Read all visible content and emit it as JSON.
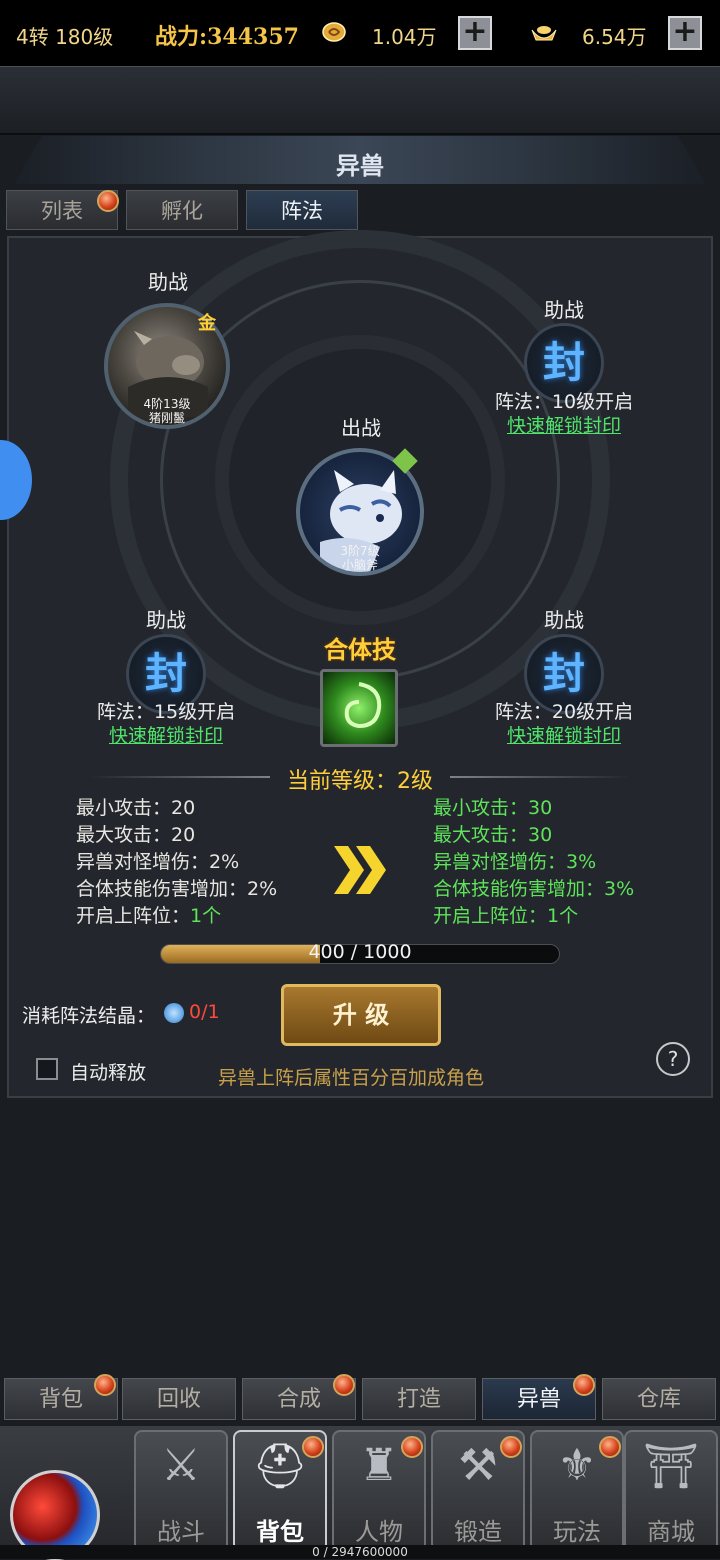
{
  "resources": {
    "level": "4转 180级",
    "power": "战力:344357",
    "coin_amount": "1.04万",
    "ingot_amount": "6.54万"
  },
  "header": {
    "title": "异兽"
  },
  "tabs": [
    {
      "label": "列表",
      "badge": true
    },
    {
      "label": "孵化"
    },
    {
      "label": "阵法",
      "active": true
    }
  ],
  "formation": {
    "support_label": "助战",
    "battle_label": "出战",
    "seal_glyph": "封",
    "quick_unlock": "快速解锁封印",
    "slot_top_left": {
      "caption_rank": "4阶13级",
      "caption_name": "猪刚鬣",
      "badge": "金"
    },
    "slot_center": {
      "caption_rank": "3阶7级",
      "caption_name": "小脑斧"
    },
    "slot_top_right": {
      "unlock": "阵法：10级开启"
    },
    "slot_bottom_left": {
      "unlock": "阵法：15级开启"
    },
    "slot_bottom_right": {
      "unlock": "阵法：20级开启"
    },
    "combo_skill_label": "合体技"
  },
  "level_info": {
    "current_level": "当前等级：2级"
  },
  "stats_current": [
    "最小攻击：20",
    "最大攻击：20",
    "异兽对怪增伤：2%",
    "合体技能伤害增加：2%"
  ],
  "stats_current_slots": {
    "label": "开启上阵位：",
    "value": "1个"
  },
  "stats_next": [
    "最小攻击：30",
    "最大攻击：30",
    "异兽对怪增伤：3%",
    "合体技能伤害增加：3%",
    "开启上阵位：1个"
  ],
  "progress": {
    "text": "400 / 1000",
    "fraction": 0.4
  },
  "cost": {
    "label": "消耗阵法结晶：",
    "value": "0/1"
  },
  "upgrade_button": "升 级",
  "auto_release": "自动释放",
  "hint": "异兽上阵后属性百分百加成角色",
  "help_glyph": "?",
  "bottom_tabs": [
    {
      "label": "背包",
      "badge": true
    },
    {
      "label": "回收"
    },
    {
      "label": "合成",
      "badge": true
    },
    {
      "label": "打造"
    },
    {
      "label": "异兽",
      "badge": true,
      "active": true
    },
    {
      "label": "仓库"
    }
  ],
  "nav": [
    {
      "label": "战斗"
    },
    {
      "label": "背包",
      "badge": true,
      "active": true
    },
    {
      "label": "人物",
      "badge": true
    },
    {
      "label": "锻造",
      "badge": true
    },
    {
      "label": "玩法",
      "badge": true
    },
    {
      "label": "商城"
    }
  ],
  "exp_text": "0 / 2947600000"
}
